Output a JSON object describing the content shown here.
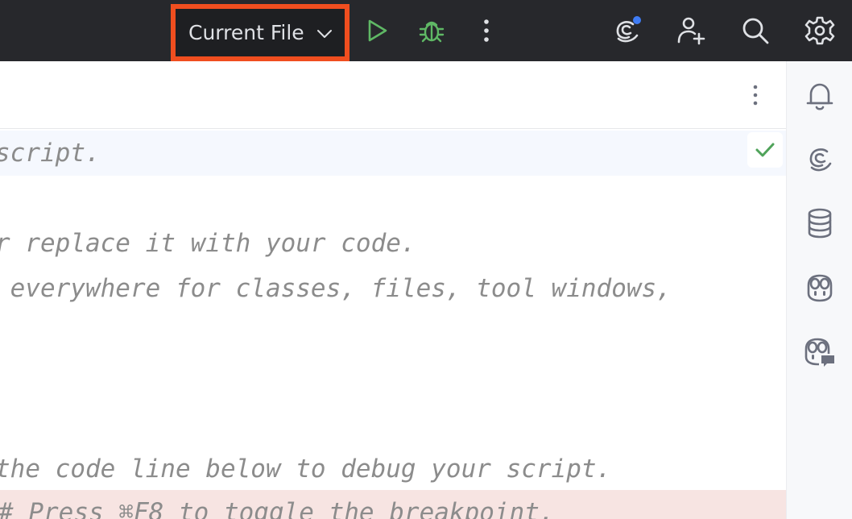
{
  "toolbar": {
    "run_config_label": "Current File"
  },
  "editor": {
    "lines": [
      "script.",
      "r replace it with your code.",
      " everywhere for classes, files, tool windows,",
      "the code line below to debug your script.",
      "# Press ⌘F8 to toggle the breakpoint."
    ]
  },
  "colors": {
    "toolbar_bg": "#27282c",
    "highlight_border": "#f04e1f",
    "run_green": "#5fb865",
    "notification_dot": "#3f7cf5",
    "comment_gray": "#8c8c8c",
    "breakpoint_line": "#f7e4e2"
  },
  "icons": {
    "run_config_dropdown": "chevron-down-icon",
    "run": "play-icon",
    "debug": "bug-icon",
    "more": "more-vertical-icon",
    "ai_assistant": "ai-assistant-icon",
    "add_user": "add-user-icon",
    "search": "search-icon",
    "settings": "gear-icon",
    "notifications": "bell-icon",
    "database": "database-icon",
    "copilot": "copilot-icon",
    "copilot_chat": "copilot-chat-icon",
    "inspections_ok": "check-icon"
  }
}
